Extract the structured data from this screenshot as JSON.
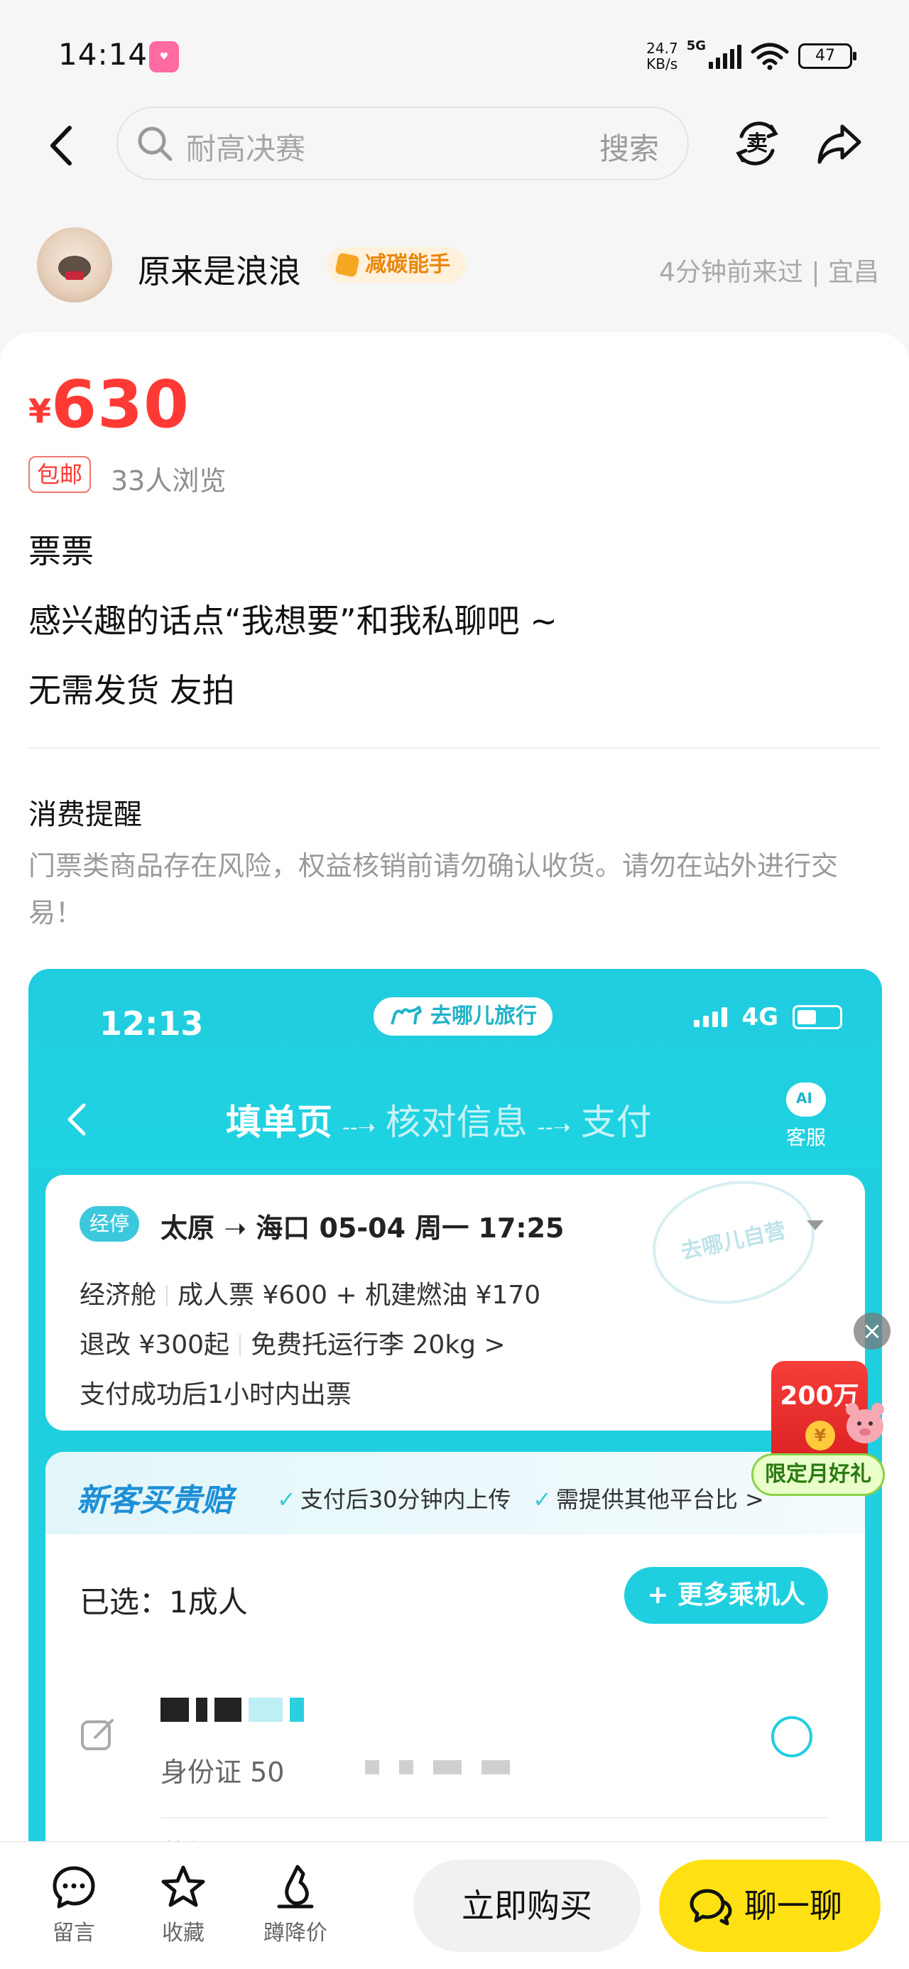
{
  "status_bar": {
    "time": "14:14",
    "net_speed_value": "24.7",
    "net_speed_unit": "KB/s",
    "network": "5G",
    "battery": "47"
  },
  "nav": {
    "search_placeholder": "耐高决赛",
    "search_button": "搜索",
    "sell_icon_text": "卖"
  },
  "seller": {
    "name": "原来是浪浪",
    "badge": "减碳能手",
    "meta": "4分钟前来过 | 宜昌"
  },
  "item": {
    "currency": "¥",
    "price": "630",
    "shipping_tag": "包邮",
    "views": "33人浏览",
    "desc_line1": "票票",
    "desc_line2": "感兴趣的话点“我想要”和我私聊吧 ~",
    "desc_line3": "无需发货 友拍"
  },
  "reminder": {
    "title": "消费提醒",
    "body": "门票类商品存在风险，权益核销前请勿确认收货。请勿在站外进行交易！"
  },
  "embedded_screenshot": {
    "time": "12:13",
    "brand": "去哪儿旅行",
    "network": "4G",
    "step_current": "填单页",
    "step_2": "核对信息",
    "step_3": "支付",
    "arrow": "--➝",
    "service_label": "客服",
    "flight": {
      "badge": "经停",
      "route": "太原 ➝ 海口  05-04  周一  17:25",
      "stamp": "去哪儿自营",
      "line1_a": "经济舱",
      "line1_b": "成人票 ¥600 + 机建燃油 ¥170",
      "line2_a": "退改 ¥300起",
      "line2_b": "免费托运行李 20kg >",
      "line3": "支付成功后1小时内出票"
    },
    "guarantee": {
      "title": "新客买贵赔",
      "point1": "支付后30分钟内上传",
      "point2": "需提供其他平台比 >",
      "check": "✓",
      "selected": "已选：1成人",
      "more_passengers": "+ 更多乘机人",
      "passenger_id_label": "身份证 50",
      "next_passenger": "菲媛"
    }
  },
  "promo": {
    "close": "×",
    "amount": "200万",
    "coin": "¥",
    "label": "限定月好礼"
  },
  "bottom_bar": {
    "message": "留言",
    "favorite": "收藏",
    "price_drop": "蹲降价",
    "buy": "立即购买",
    "chat": "聊一聊"
  },
  "colors": {
    "price_red": "#ff3a34",
    "chat_yellow": "#ffe113",
    "qunar_cyan": "#1fcfe0"
  }
}
